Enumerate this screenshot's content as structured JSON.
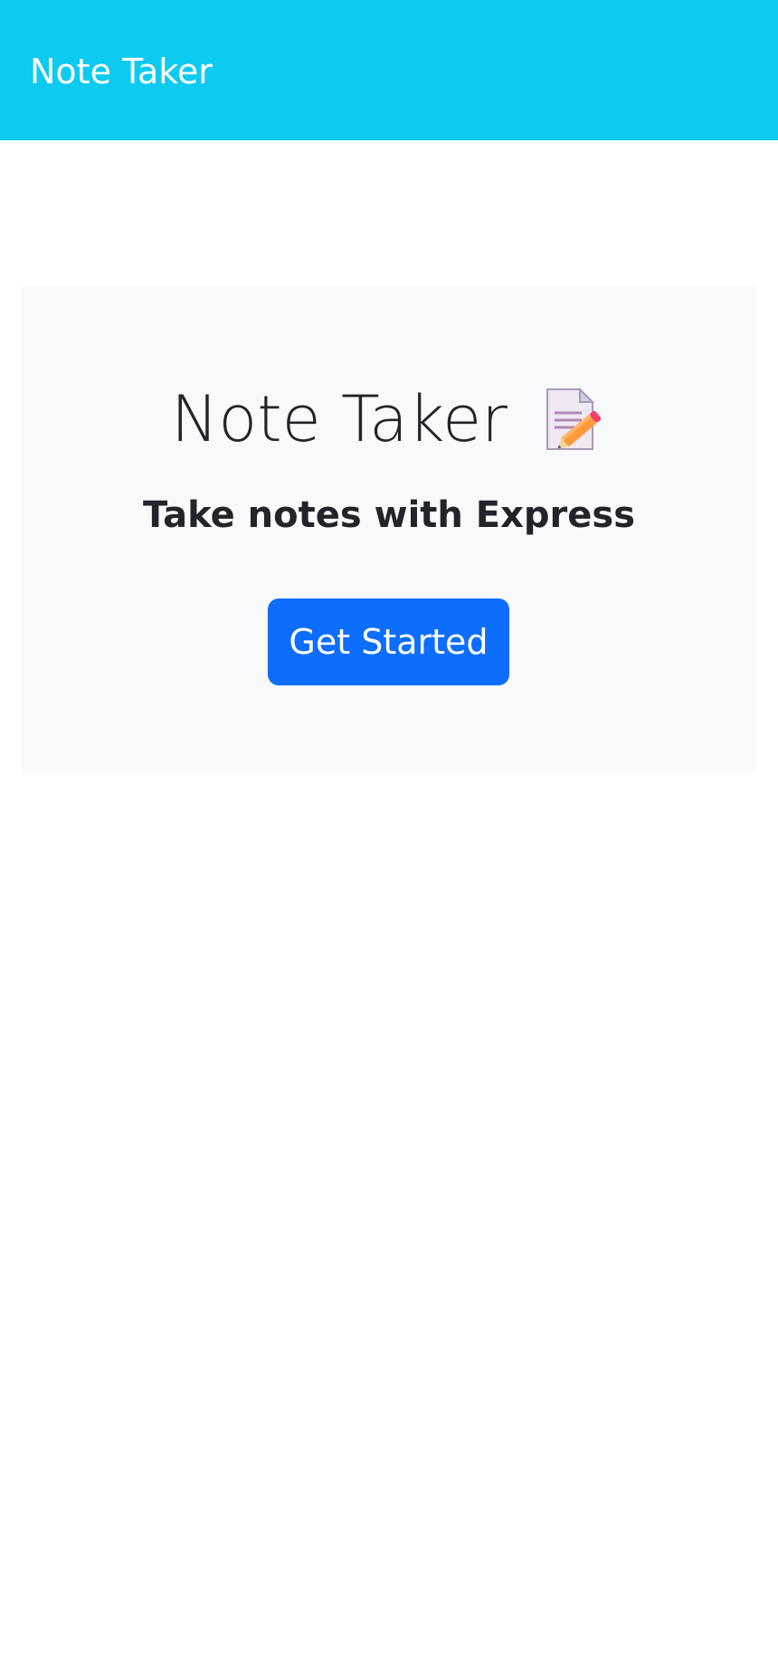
{
  "navbar": {
    "brand": "Note Taker"
  },
  "hero": {
    "title": "Note Taker",
    "title_icon": "memo-icon",
    "subtitle": "Take notes with Express",
    "cta_label": "Get Started"
  },
  "colors": {
    "navbar_bg": "#0dcaf0",
    "jumbotron_bg": "#f8f9fa",
    "primary_button": "#0d6efd",
    "text": "#212529"
  }
}
